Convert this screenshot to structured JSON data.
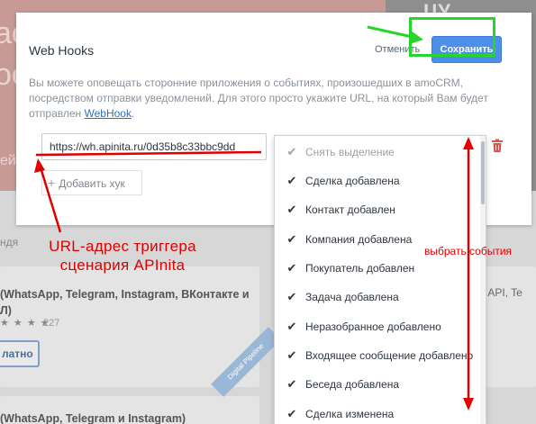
{
  "background": {
    "banner_line1": "ас",
    "banner_line2": "ое",
    "banner_small": "ейт",
    "top_right": "ЦУ",
    "section_label": "ндя",
    "card1_title": "(WhatsApp, Telegram, Instagram, ВКонтакте и Л)",
    "card1_stars": "★ ★ ★ ★",
    "card1_count": "227",
    "card1_button": "латно",
    "card1_ribbon": "Digital Pipeline",
    "card2_title": "(WhatsApp, Telegram и Instagram)",
    "right_text": "ess API, Te"
  },
  "modal": {
    "title": "Web Hooks",
    "cancel_label": "Отменить",
    "save_label": "Сохранить",
    "description_text": "Вы можете оповещать сторонние приложения о событиях, произошедших в amoCRM, посредством отправки уведомлений. Для этого просто укажите URL, на который Вам будет отправлен ",
    "description_link": "WebHook",
    "description_end": ".",
    "url_value": "https://wh.apinita.ru/0d35b8c33bbc9dd",
    "add_hook_label": "Добавить хук",
    "delete_icon": "trash-icon"
  },
  "events_dropdown": {
    "deselect_label": "Снять выделение",
    "items": [
      {
        "label": "Сделка добавлена",
        "checked": true
      },
      {
        "label": "Контакт добавлен",
        "checked": true
      },
      {
        "label": "Компания добавлена",
        "checked": true
      },
      {
        "label": "Покупатель добавлен",
        "checked": true
      },
      {
        "label": "Задача добавлена",
        "checked": true
      },
      {
        "label": "Неразобранное добавлено",
        "checked": true
      },
      {
        "label": "Входящее сообщение добавлено",
        "checked": true
      },
      {
        "label": "Беседа добавлена",
        "checked": true
      },
      {
        "label": "Сделка изменена",
        "checked": true
      }
    ]
  },
  "annotations": {
    "url_label_line1": "URL-адрес триггера",
    "url_label_line2": "сценария APInita",
    "events_label": "выбрать события",
    "colors": {
      "red": "#e00000",
      "green": "#24d62b"
    }
  },
  "colors": {
    "save_button": "#4d8ee8",
    "link": "#2f6fc1",
    "text": "#2e3640",
    "muted_text": "#8a929b"
  }
}
